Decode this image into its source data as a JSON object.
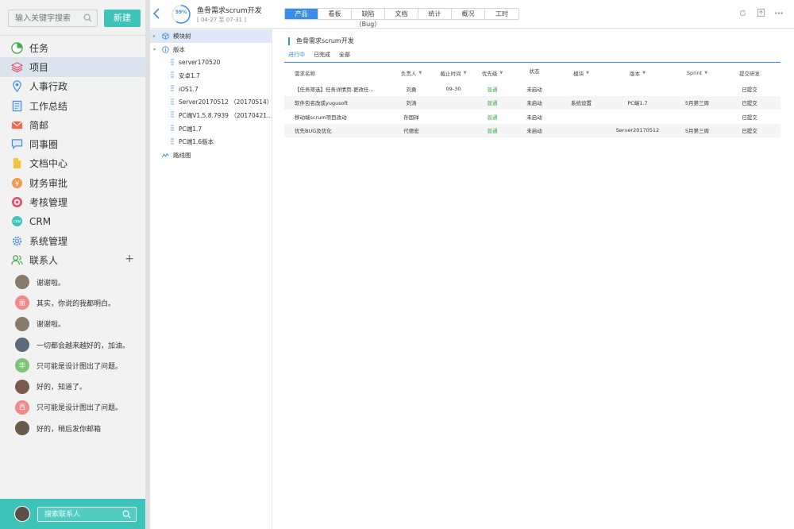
{
  "sidebar": {
    "search_placeholder": "输入关键字搜索",
    "new_button": "新建",
    "nav": [
      {
        "label": "任务",
        "icon": "task-pie-icon",
        "color": "#3fae49"
      },
      {
        "label": "项目",
        "icon": "layers-icon",
        "color": "#e8516d"
      },
      {
        "label": "人事行政",
        "icon": "location-pin-icon",
        "color": "#4a90e2"
      },
      {
        "label": "工作总结",
        "icon": "document-list-icon",
        "color": "#4a90e2"
      },
      {
        "label": "简邮",
        "icon": "mail-icon",
        "color": "#f2664b"
      },
      {
        "label": "同事圈",
        "icon": "chat-bubble-icon",
        "color": "#4a90e2"
      },
      {
        "label": "文档中心",
        "icon": "file-icon",
        "color": "#f5c242"
      },
      {
        "label": "财务审批",
        "icon": "yen-icon",
        "color": "#f2994a"
      },
      {
        "label": "考核管理",
        "icon": "target-icon",
        "color": "#e8516d"
      },
      {
        "label": "CRM",
        "icon": "crm-icon",
        "color": "#3ec3b8"
      },
      {
        "label": "系统管理",
        "icon": "gear-icon",
        "color": "#4a90e2"
      },
      {
        "label": "联系人",
        "icon": "contacts-icon",
        "color": "#3fae49"
      }
    ],
    "active_nav_index": 1,
    "contacts": [
      {
        "text": "谢谢啦。",
        "avatar_color": "#8a7a6a",
        "avatar_text": ""
      },
      {
        "text": "其实，你说的我都明白。",
        "avatar_color": "#f08a8a",
        "avatar_text": "丽"
      },
      {
        "text": "谢谢啦。",
        "avatar_color": "#8a7a6a",
        "avatar_text": ""
      },
      {
        "text": "一切都会越来越好的，加油。",
        "avatar_color": "#5a6a7a",
        "avatar_text": ""
      },
      {
        "text": "只可能是设计图出了问题。",
        "avatar_color": "#7cc576",
        "avatar_text": "华"
      },
      {
        "text": "好的，知道了。",
        "avatar_color": "#7a5a4a",
        "avatar_text": ""
      },
      {
        "text": "只可能是设计图出了问题。",
        "avatar_color": "#f08a8a",
        "avatar_text": "西"
      },
      {
        "text": "好的，稍后发你邮箱",
        "avatar_color": "#6a5a4a",
        "avatar_text": ""
      }
    ],
    "contact_search_placeholder": "搜索联系人"
  },
  "header": {
    "progress": "59%",
    "progress_value": 0.59,
    "title": "鱼骨需求scrum开发",
    "date_range": "[ 04-27 至 07-31 ]",
    "tabs": [
      "产品",
      "看板",
      "缺陷（Bug）",
      "文档",
      "统计",
      "概况",
      "工时"
    ],
    "active_tab": 0
  },
  "tree": {
    "root": "模块树",
    "version_group": "版本",
    "versions": [
      "server170520",
      "安卓1.7",
      "iOS1.7",
      "Server20170512 （20170514）",
      "PC端V1.5.8.7939 （20170421…",
      "PC端1.7",
      "PC端1.6版本"
    ],
    "roadmap": "路线图"
  },
  "content": {
    "title": "鱼骨需求scrum开发",
    "filters": [
      "进行中",
      "已完成",
      "全部"
    ],
    "active_filter": 0,
    "columns": [
      "需求名称",
      "负责人",
      "截止时间",
      "优先级",
      "状态",
      "模块",
      "版本",
      "Sprint",
      "提交研发"
    ],
    "rows": [
      {
        "name": "【任务筛选】任务详情页-更改任…",
        "owner": "刘勇",
        "deadline": "09-30",
        "priority": "普通",
        "status": "未启动",
        "module": "",
        "version": "",
        "sprint": "",
        "submit": "已提交"
      },
      {
        "name": "软件包名改成yugusoft",
        "owner": "刘涛",
        "deadline": "",
        "priority": "普通",
        "status": "未启动",
        "module": "系统设置",
        "version": "PC端1.7",
        "sprint": "5月第三周",
        "submit": "已提交"
      },
      {
        "name": "移动端scrum项目改动",
        "owner": "孙国祥",
        "deadline": "",
        "priority": "普通",
        "status": "未启动",
        "module": "",
        "version": "",
        "sprint": "",
        "submit": "已提交"
      },
      {
        "name": "优先BUG及优化",
        "owner": "代德宏",
        "deadline": "",
        "priority": "普通",
        "status": "未启动",
        "module": "",
        "version": "Server20170512",
        "sprint": "5月第三周",
        "submit": "已提交"
      }
    ]
  }
}
